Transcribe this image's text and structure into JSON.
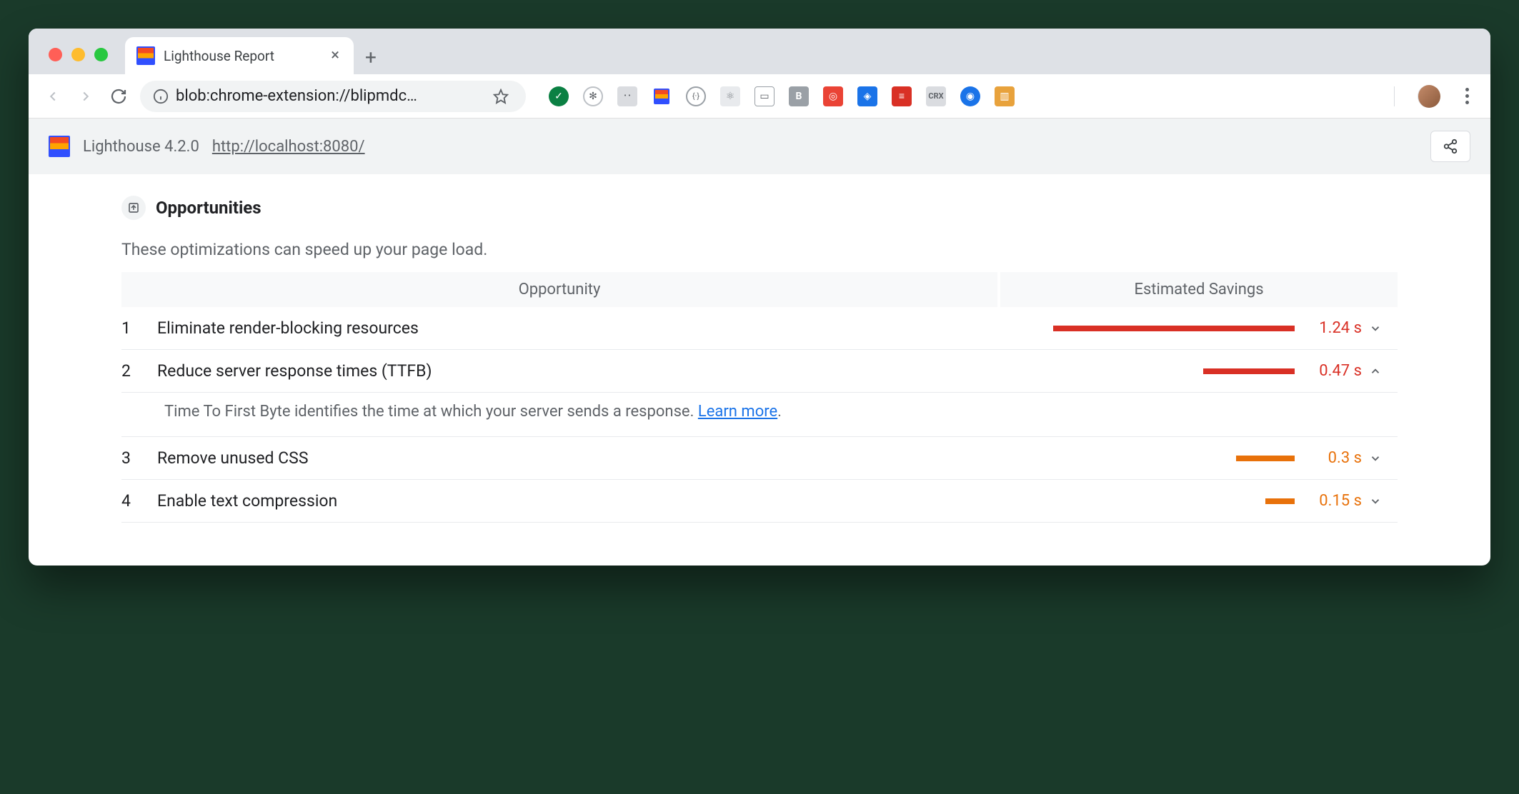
{
  "browser": {
    "tab_title": "Lighthouse Report",
    "url_display": "blob:chrome-extension://blipmdc…"
  },
  "header": {
    "product": "Lighthouse 4.2.0",
    "audited_url": "http://localhost:8080/"
  },
  "section": {
    "title": "Opportunities",
    "subtitle": "These optimizations can speed up your page load.",
    "col_opportunity": "Opportunity",
    "col_savings": "Estimated Savings"
  },
  "rows": [
    {
      "n": "1",
      "title": "Eliminate render-blocking resources",
      "value": "1.24 s",
      "sev": "red",
      "bar": 338,
      "expanded": false
    },
    {
      "n": "2",
      "title": "Reduce server response times (TTFB)",
      "value": "0.47 s",
      "sev": "red",
      "bar": 128,
      "expanded": true
    },
    {
      "n": "3",
      "title": "Remove unused CSS",
      "value": "0.3 s",
      "sev": "org",
      "bar": 82,
      "expanded": false
    },
    {
      "n": "4",
      "title": "Enable text compression",
      "value": "0.15 s",
      "sev": "org",
      "bar": 41,
      "expanded": false
    }
  ],
  "detail": {
    "text": "Time To First Byte identifies the time at which your server sends a response. ",
    "link": "Learn more",
    "suffix": "."
  }
}
